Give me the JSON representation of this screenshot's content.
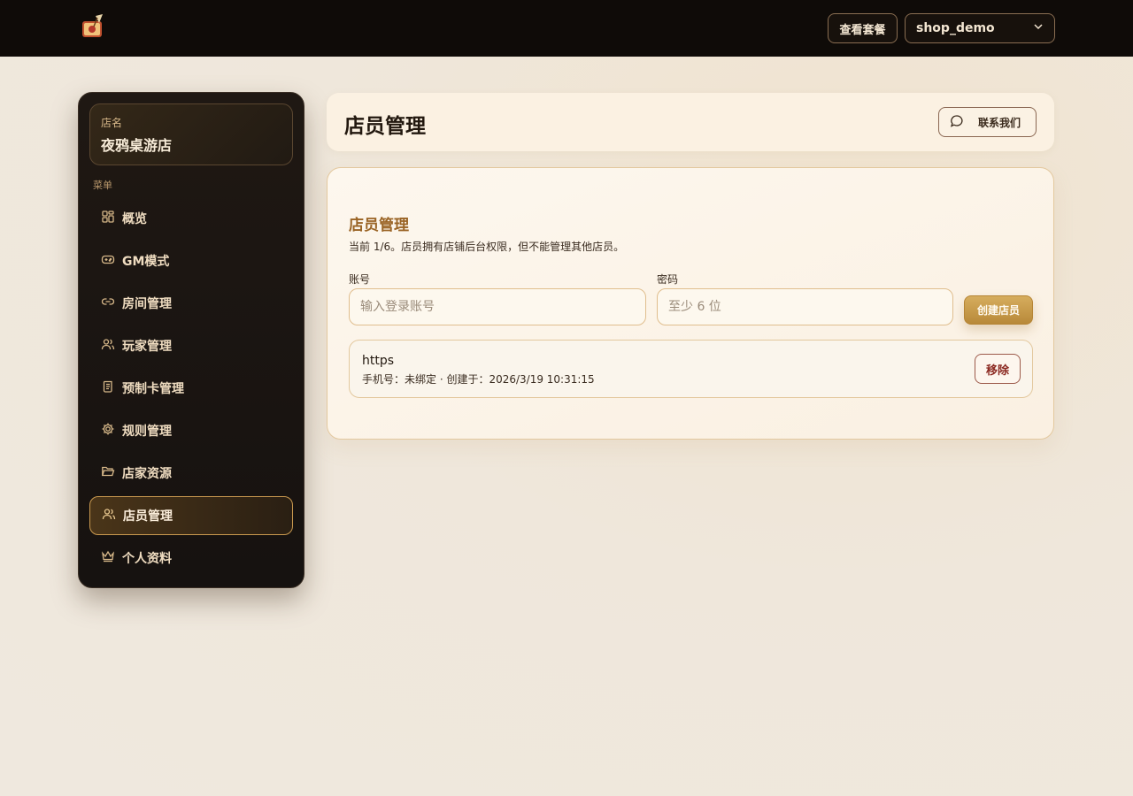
{
  "topbar": {
    "logo_icon": "book-quill-icon",
    "plan_button": "查看套餐",
    "shop_select": {
      "value": "shop_demo",
      "icon": "chevron-down-icon"
    }
  },
  "sidebar": {
    "store_label": "店名",
    "store_name": "夜鸦桌游店",
    "menu_title": "菜单",
    "items": [
      {
        "label": "概览",
        "icon": "grid-icon",
        "active": false
      },
      {
        "label": "GM模式",
        "icon": "gamepad-icon",
        "active": false
      },
      {
        "label": "房间管理",
        "icon": "link-icon",
        "active": false
      },
      {
        "label": "玩家管理",
        "icon": "users-icon",
        "active": false
      },
      {
        "label": "预制卡管理",
        "icon": "scroll-icon",
        "active": false
      },
      {
        "label": "规则管理",
        "icon": "gear-icon",
        "active": false
      },
      {
        "label": "店家资源",
        "icon": "folder-icon",
        "active": false
      },
      {
        "label": "店员管理",
        "icon": "users-icon",
        "active": true
      },
      {
        "label": "个人资料",
        "icon": "crown-icon",
        "active": false
      }
    ]
  },
  "header": {
    "title": "店员管理",
    "contact_button": "联系我们",
    "contact_icon": "chat-bubble-icon"
  },
  "main": {
    "section_title": "店员管理",
    "description": "当前 1/6。店员拥有店铺后台权限，但不能管理其他店员。",
    "account_label": "账号",
    "account_placeholder": "输入登录账号",
    "password_label": "密码",
    "password_placeholder": "至少 6 位",
    "create_button": "创建店员",
    "staff": [
      {
        "name": "https",
        "meta": "手机号：未绑定 · 创建于：2026/3/19 10:31:15",
        "remove_button": "移除"
      }
    ]
  },
  "colors": {
    "topbar_bg": "#0f0b08",
    "sidebar_bg": "#1f1813",
    "accent_gold": "#c9994f",
    "section_title": "#9a6425",
    "remove_text": "#8c2a22"
  }
}
